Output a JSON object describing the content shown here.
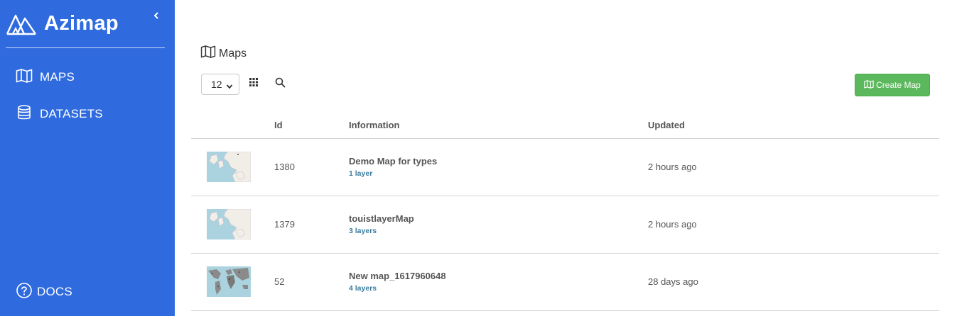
{
  "sidebar": {
    "brand": "Azimap",
    "items": [
      {
        "label": "MAPS",
        "icon": "map-icon"
      },
      {
        "label": "DATASETS",
        "icon": "database-icon"
      }
    ],
    "docs_label": "DOCS"
  },
  "page": {
    "title": "Maps",
    "page_size": "12",
    "create_label": "Create Map"
  },
  "table": {
    "headers": {
      "id": "Id",
      "information": "Information",
      "updated": "Updated"
    },
    "rows": [
      {
        "id": "1380",
        "name": "Demo Map for types",
        "layers": "1 layer",
        "updated": "2 hours ago"
      },
      {
        "id": "1379",
        "name": "touistlayerMap",
        "layers": "3 layers",
        "updated": "2 hours ago"
      },
      {
        "id": "52",
        "name": "New map_1617960648",
        "layers": "4 layers",
        "updated": "28 days ago"
      }
    ]
  },
  "colors": {
    "sidebar": "#2f6bdf",
    "create_button": "#5cb85c",
    "layer_link": "#3a7c9e"
  }
}
